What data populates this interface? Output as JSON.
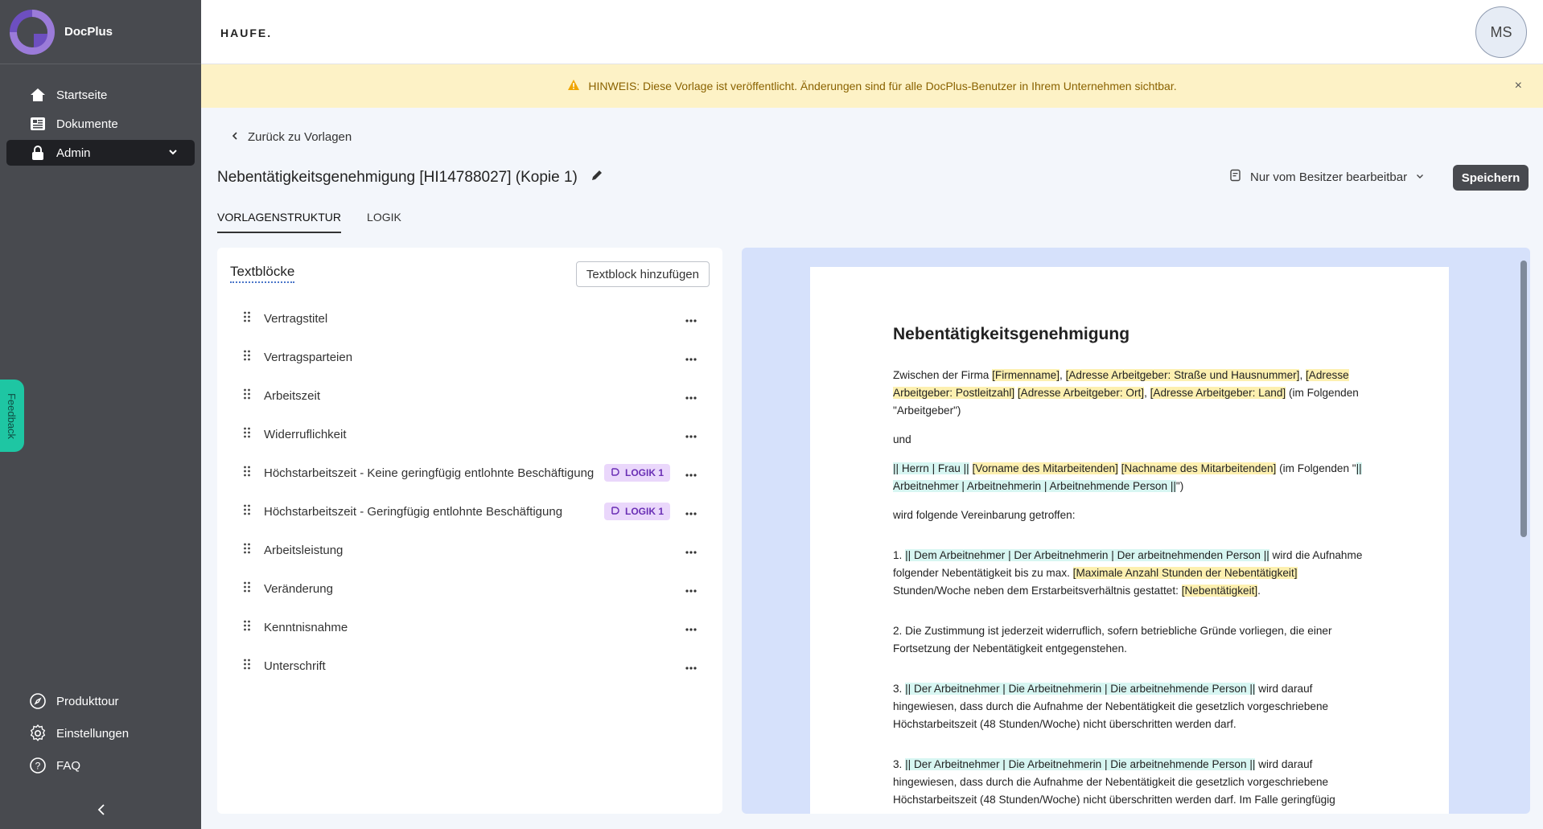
{
  "app": {
    "name": "DocPlus",
    "publisher_logo": "HAUFE.",
    "user_initials": "MS"
  },
  "sidebar": {
    "items": [
      {
        "label": "Startseite",
        "icon": "home-icon"
      },
      {
        "label": "Dokumente",
        "icon": "documents-icon"
      },
      {
        "label": "Admin",
        "icon": "lock-icon",
        "active": true
      }
    ],
    "bottom_items": [
      {
        "label": "Produkttour",
        "icon": "compass-icon"
      },
      {
        "label": "Einstellungen",
        "icon": "gear-icon"
      },
      {
        "label": "FAQ",
        "icon": "help-icon"
      }
    ],
    "feedback_label": "Feedback"
  },
  "notice": {
    "text": "HINWEIS: Diese Vorlage ist veröffentlicht. Änderungen sind für alle DocPlus-Benutzer in Ihrem Unternehmen sichtbar."
  },
  "header": {
    "back_label": "Zurück zu Vorlagen",
    "title": "Nebentätigkeitsgenehmigung [HI14788027] (Kopie 1)",
    "permission": "Nur vom Besitzer bearbeitbar",
    "save_label": "Speichern"
  },
  "tabs": [
    {
      "label": "VORLAGENSTRUKTUR",
      "active": true
    },
    {
      "label": "LOGIK",
      "active": false
    }
  ],
  "textblocks": {
    "title": "Textblöcke",
    "add_label": "Textblock hinzufügen",
    "items": [
      {
        "label": "Vertragstitel",
        "badge": ""
      },
      {
        "label": "Vertragsparteien",
        "badge": ""
      },
      {
        "label": "Arbeitszeit",
        "badge": ""
      },
      {
        "label": "Widerruflichkeit",
        "badge": ""
      },
      {
        "label": "Höchstarbeitszeit - Keine geringfügig entlohnte Beschäftigung",
        "badge": "LOGIK 1"
      },
      {
        "label": "Höchstarbeitszeit - Geringfügig entlohnte Beschäftigung",
        "badge": "LOGIK 1"
      },
      {
        "label": "Arbeitsleistung",
        "badge": ""
      },
      {
        "label": "Veränderung",
        "badge": ""
      },
      {
        "label": "Kenntnisnahme",
        "badge": ""
      },
      {
        "label": "Unterschrift",
        "badge": ""
      }
    ]
  },
  "preview": {
    "heading": "Nebentätigkeitsgenehmigung",
    "p1_a": "Zwischen der Firma ",
    "p1_f1": "[Firmenname]",
    "p1_s1": ", ",
    "p1_f2": "[Adresse Arbeitgeber: Straße und Hausnummer]",
    "p1_s2": ", ",
    "p1_f3": "[Adresse Arbeitgeber: Postleitzahl]",
    "p1_s3": " ",
    "p1_f4": "[Adresse Arbeitgeber: Ort]",
    "p1_s4": ", ",
    "p1_f5": "[Adresse Arbeitgeber: Land]",
    "p1_b": " (im Folgenden \"Arbeitgeber\")",
    "und": "und",
    "p2_t1": "|| Herrn | Frau ||",
    "p2_s1": " ",
    "p2_f1": "[Vorname des Mitarbeitenden]",
    "p2_s2": " ",
    "p2_f2": "[Nachname des Mitarbeitenden]",
    "p2_b": " (im Folgenden \"",
    "p2_t2": "|| Arbeitnehmer | Arbeitnehmerin | Arbeitnehmende Person ||",
    "p2_c": "\")",
    "p3": "wird folgende Vereinbarung getroffen:",
    "p4_a": "1. ",
    "p4_t1": "|| Dem Arbeitnehmer | Der Arbeitnehmerin | Der arbeitnehmenden Person ||",
    "p4_b": " wird die Aufnahme folgender Nebentätigkeit bis zu max. ",
    "p4_f1": "[Maximale Anzahl Stunden der Nebentätigkeit]",
    "p4_c": " Stunden/Woche neben dem Erstarbeitsverhältnis gestattet: ",
    "p4_f2": "[Nebentätigkeit]",
    "p4_d": ".",
    "p5": "2. Die Zustimmung ist jederzeit widerruflich, sofern betriebliche Gründe vorliegen, die einer Fortsetzung der Nebentätigkeit entgegenstehen.",
    "p6_a": "3. ",
    "p6_t1": "|| Der Arbeitnehmer | Die Arbeitnehmerin | Die arbeitnehmende Person ||",
    "p6_b": " wird darauf hingewiesen, dass durch die Aufnahme der Nebentätigkeit die gesetzlich vorgeschriebene Höchstarbeitszeit (48 Stunden/Woche) nicht überschritten werden darf.",
    "p7_a": "3. ",
    "p7_t1": "|| Der Arbeitnehmer | Die Arbeitnehmerin | Die arbeitnehmende Person ||",
    "p7_b": " wird darauf hingewiesen, dass durch die Aufnahme der Nebentätigkeit die gesetzlich vorgeschriebene Höchstarbeitszeit (48 Stunden/Woche) nicht überschritten werden darf. Im Falle geringfügig"
  },
  "colors": {
    "sidebar": "#484a4f",
    "notice_bg": "#fdf2c6",
    "badge_bg": "#ead7fb",
    "field_yellow": "#fdf0b0",
    "field_teal": "#d7f6f2"
  }
}
